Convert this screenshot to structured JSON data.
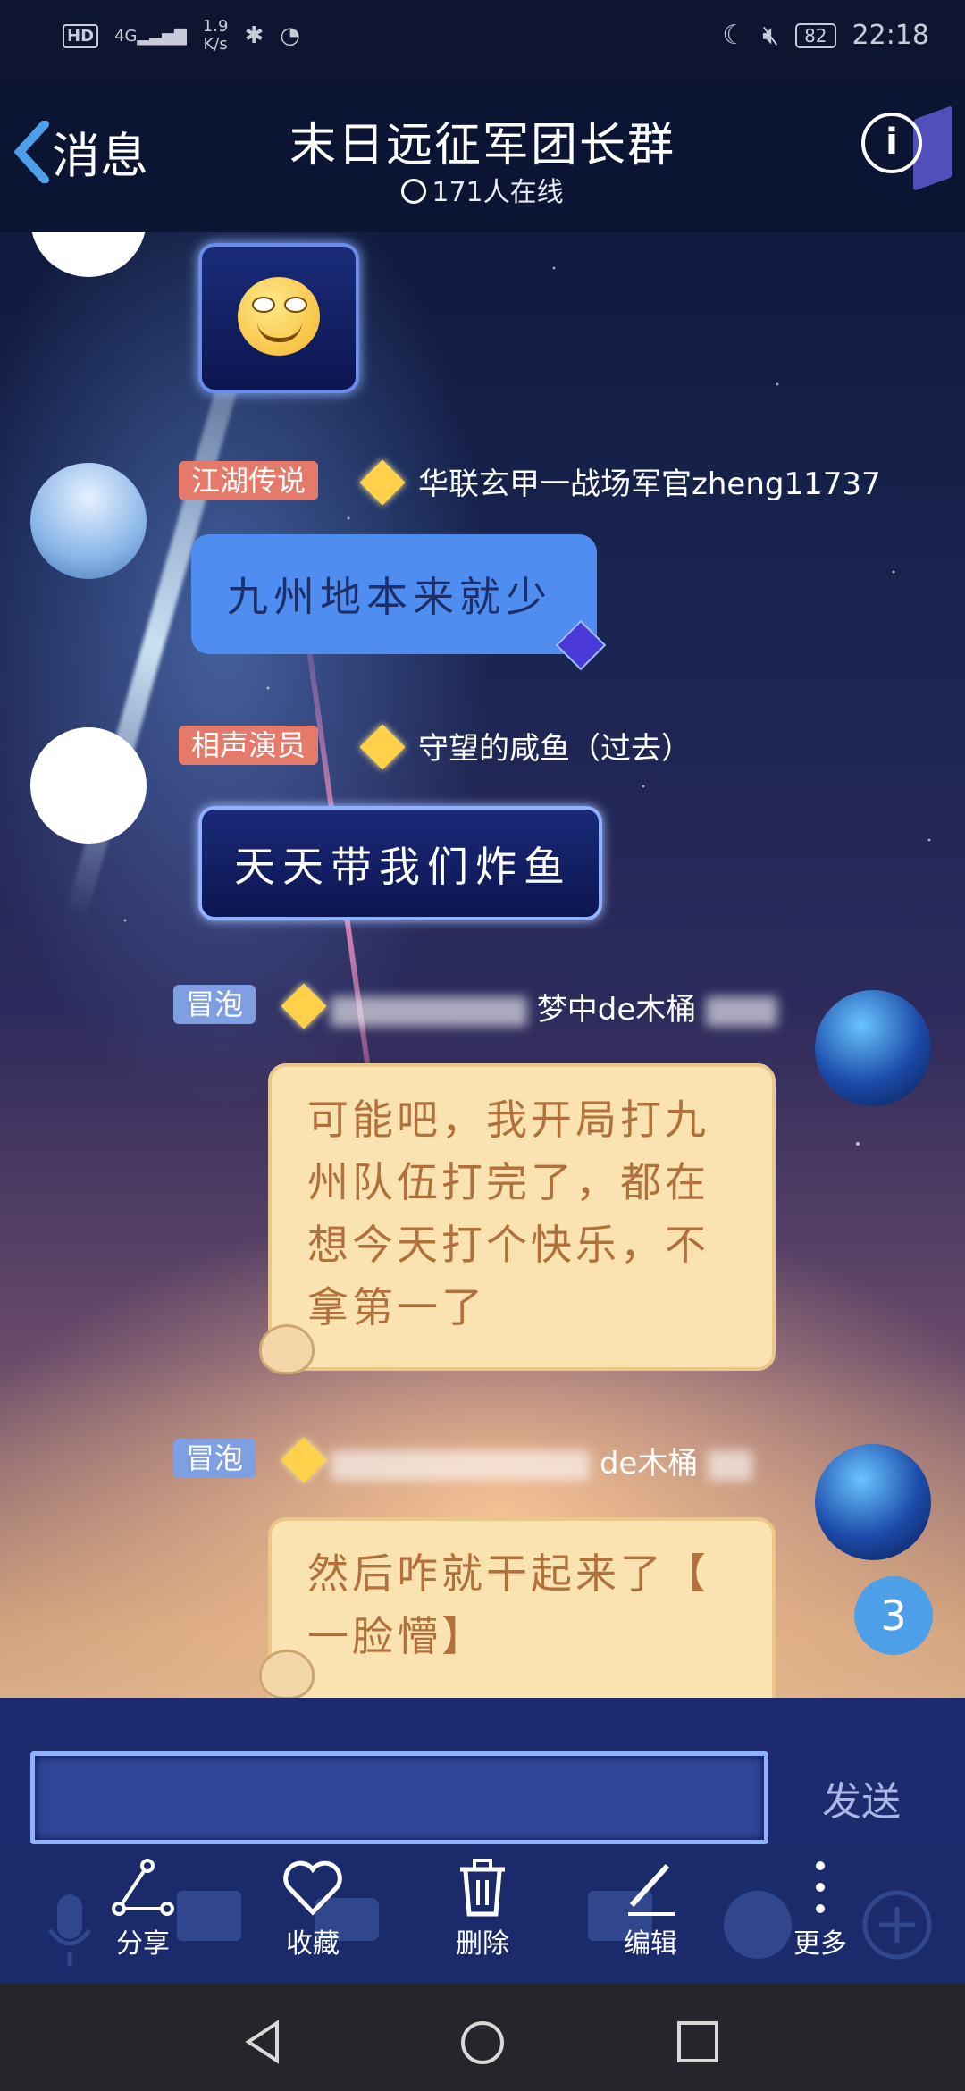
{
  "status_bar": {
    "hd": "HD",
    "network": "4G",
    "speed": "1.9",
    "speed_unit": "K/s",
    "battery": "82",
    "time": "22:18"
  },
  "header": {
    "back_label": "消息",
    "title": "末日远征军团长群",
    "online": "171人在线"
  },
  "messages": [
    {
      "type": "emoji",
      "sender": ""
    },
    {
      "tag": "江湖传说",
      "sender": "华联玄甲一战场军官zheng11737",
      "text": "九州地本来就少"
    },
    {
      "tag": "相声演员",
      "sender": "守望的咸鱼（过去）",
      "text": "天天带我们炸鱼"
    },
    {
      "tag": "冒泡",
      "sender": "梦中de木桶",
      "text_lines": [
        "可能吧，我开局打九",
        "州队伍打完了，都在",
        "想今天打个快乐，不",
        "拿第一了"
      ]
    },
    {
      "tag": "冒泡",
      "sender": "de木桶",
      "text_lines": [
        "然后咋就干起来了【",
        "一脸懵】"
      ]
    }
  ],
  "unread_badge": "3",
  "composer": {
    "send_label": "发送"
  },
  "toolbar": {
    "share": "分享",
    "favorite": "收藏",
    "delete": "删除",
    "edit": "编辑",
    "more": "更多"
  }
}
